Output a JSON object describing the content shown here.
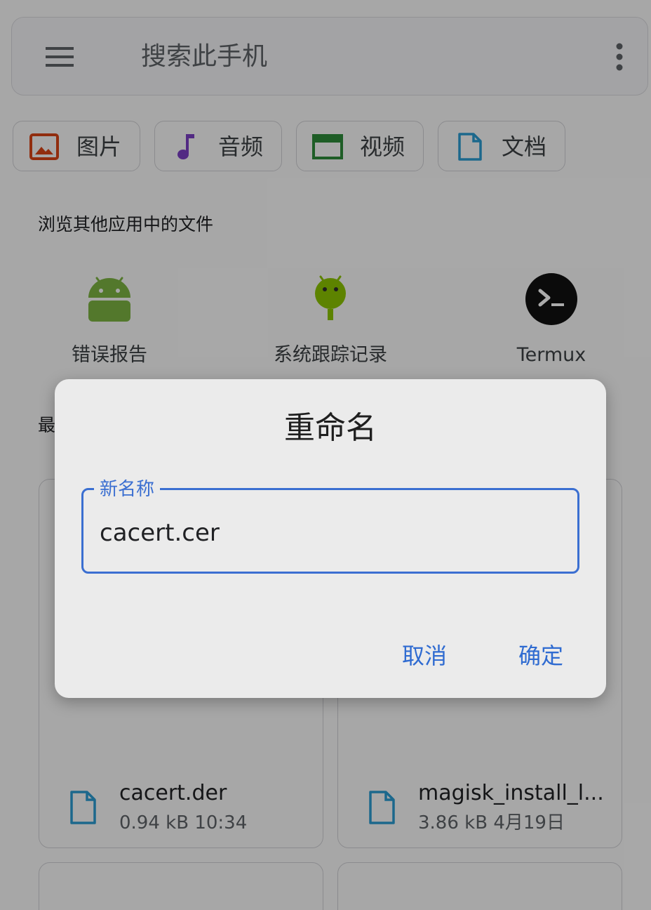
{
  "search": {
    "placeholder": "搜索此手机"
  },
  "categories": [
    {
      "label": "图片",
      "icon": "image-icon",
      "color": "#d84315"
    },
    {
      "label": "音频",
      "icon": "music-note-icon",
      "color": "#7b3fc4"
    },
    {
      "label": "视频",
      "icon": "clapperboard-icon",
      "color": "#2e8b3a"
    },
    {
      "label": "文档",
      "icon": "document-icon",
      "color": "#2a9bd1"
    }
  ],
  "other_apps": {
    "title": "浏览其他应用中的文件",
    "apps": [
      {
        "label": "错误报告",
        "icon": "android-icon"
      },
      {
        "label": "系统跟踪记录",
        "icon": "android-debug-icon"
      },
      {
        "label": "Termux",
        "icon": "terminal-icon"
      }
    ]
  },
  "recent": {
    "title": "最",
    "files": [
      {
        "name": "cacert.der",
        "meta": "0.94 kB 10:34"
      },
      {
        "name": "magisk_install_l...",
        "meta": "3.86 kB 4月19日"
      }
    ]
  },
  "rename_dialog": {
    "title": "重命名",
    "field_label": "新名称",
    "field_value": "cacert.cer",
    "cancel": "取消",
    "confirm": "确定"
  }
}
